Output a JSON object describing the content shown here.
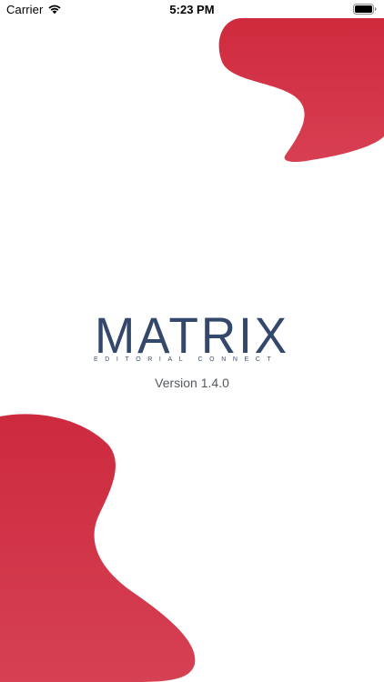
{
  "status_bar": {
    "carrier": "Carrier",
    "time": "5:23 PM",
    "wifi_icon": "wifi-icon",
    "battery_icon": "battery-icon"
  },
  "splash": {
    "logo_title": "MATRIX",
    "logo_tagline": "EDITORIAL CONNECT",
    "version": "Version 1.4.0"
  },
  "colors": {
    "brand_red": "#d23448",
    "logo_navy": "#34486b",
    "background": "#ffffff"
  }
}
